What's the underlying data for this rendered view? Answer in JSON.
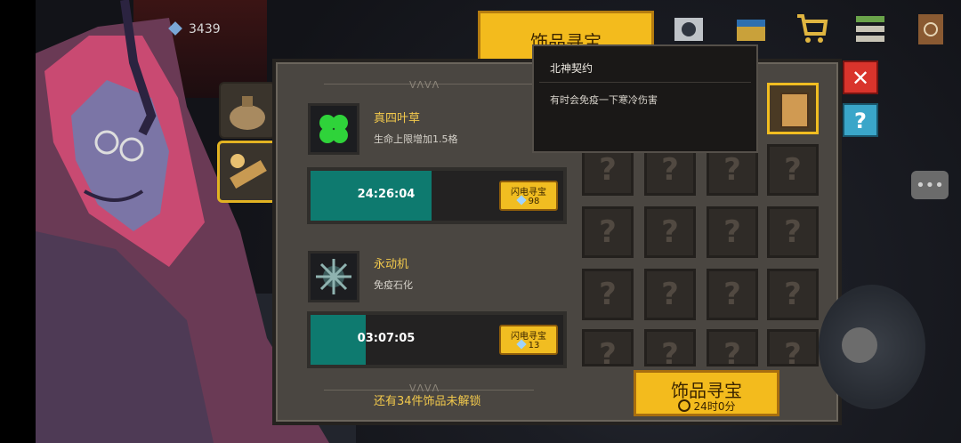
{
  "hud": {
    "coins": "3439"
  },
  "header": {
    "title": "饰品寻宝"
  },
  "tooltip": {
    "title": "北神契约",
    "description": "有时会免疫一下寒冷伤害"
  },
  "items": [
    {
      "name": "真四叶草",
      "description": "生命上限增加1.5格",
      "timer": "24:26:04",
      "progress": 0.48,
      "flash_label": "闪电寻宝",
      "flash_cost": "98"
    },
    {
      "name": "永动机",
      "description": "免疫石化",
      "timer": "03:07:05",
      "progress": 0.22,
      "flash_label": "闪电寻宝",
      "flash_cost": "13"
    }
  ],
  "grid": {
    "unknown_symbol": "?",
    "selected_column": 4
  },
  "footer": {
    "unlock_text": "还有34件饰品未解锁",
    "treasure_label": "饰品寻宝",
    "treasure_time": "24时0分"
  },
  "controls": {
    "close_glyph": "✕",
    "help_glyph": "?",
    "chat_glyph": "•••"
  },
  "colors": {
    "accent": "#f3bb1d",
    "progress": "#0e7a6f",
    "item_name": "#f2c94c"
  },
  "icons": [
    "coin-gem-icon",
    "bag-icon",
    "telescope-icon",
    "chest-icon",
    "shop-cart-icon",
    "menu-icon",
    "book-icon",
    "clover-icon",
    "gear-machine-icon",
    "scroll-icon",
    "clock-icon"
  ]
}
